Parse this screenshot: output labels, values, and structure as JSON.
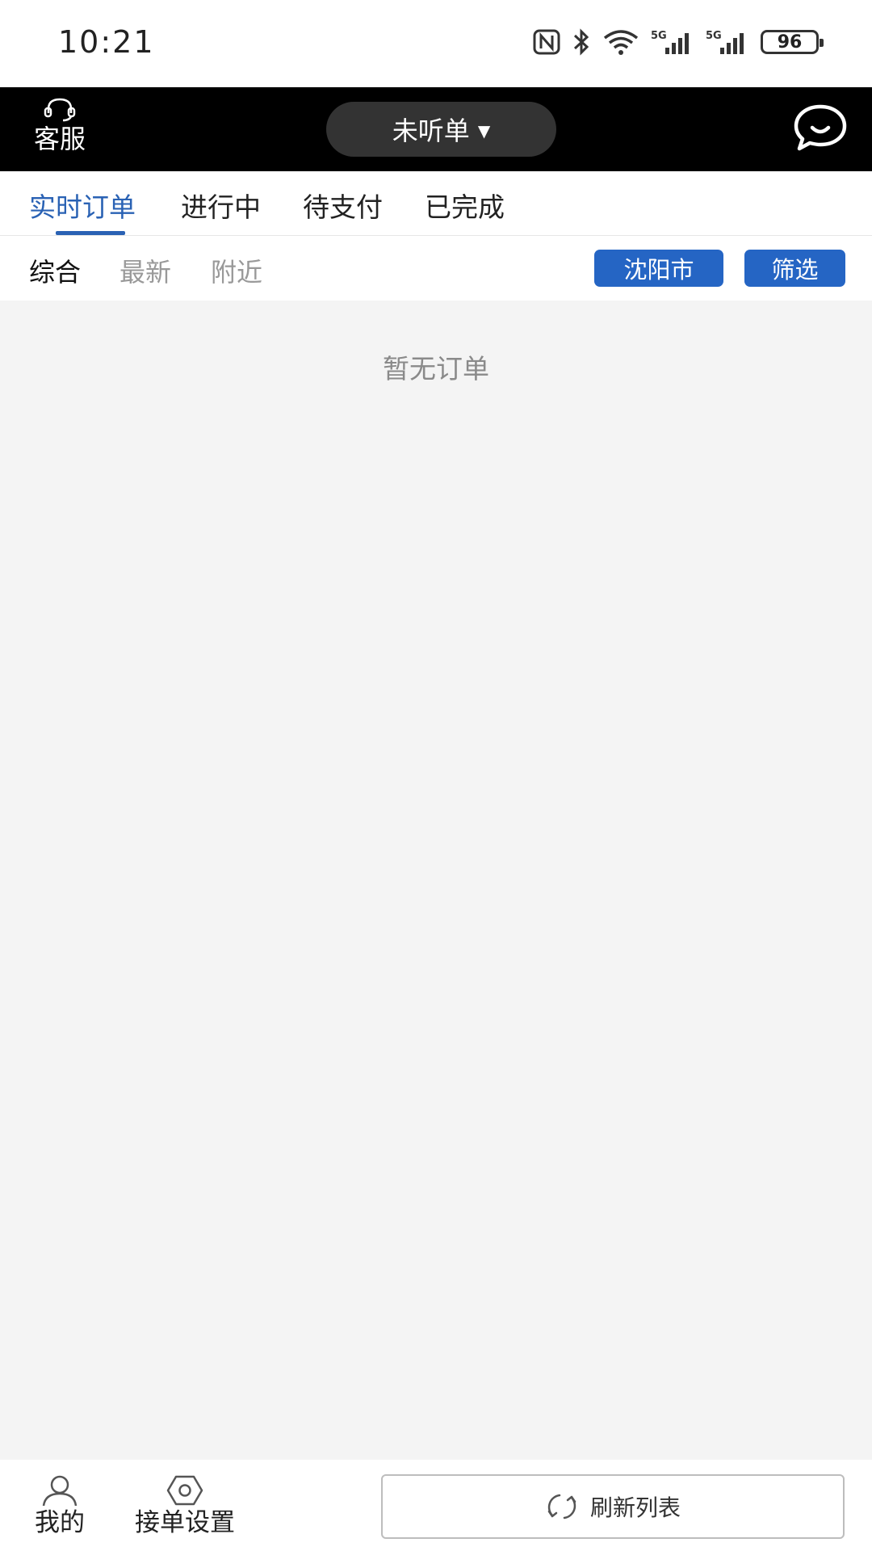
{
  "status_bar": {
    "time": "10:21",
    "battery": "96",
    "icons": [
      "nfc-icon",
      "bluetooth-icon",
      "wifi-icon",
      "signal-5g-icon",
      "signal-5g-icon",
      "battery-icon"
    ]
  },
  "header": {
    "customer_service_label": "客服",
    "mode_label": "未听单",
    "mode_caret": "▼",
    "chat_icon": "chat-bubble-icon"
  },
  "main_tabs": [
    {
      "label": "实时订单",
      "active": true
    },
    {
      "label": "进行中"
    },
    {
      "label": "待支付"
    },
    {
      "label": "已完成"
    }
  ],
  "sub_tabs": [
    {
      "label": "综合",
      "active": true
    },
    {
      "label": "最新"
    },
    {
      "label": "附近"
    }
  ],
  "filters": {
    "city": "沈阳市",
    "filter_label": "筛选"
  },
  "content": {
    "empty_text": "暂无订单"
  },
  "bottom_bar": {
    "mine_label": "我的",
    "settings_label": "接单设置",
    "refresh_label": "刷新列表"
  },
  "colors": {
    "accent": "#2a62b4",
    "pill": "#2565c4",
    "header_bg": "#000000",
    "content_bg": "#f4f4f4"
  }
}
